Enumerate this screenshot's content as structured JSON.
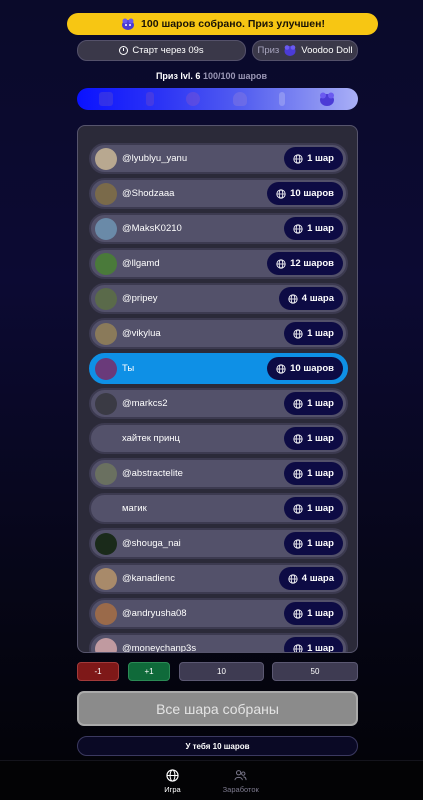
{
  "banner": {
    "text": "100 шаров собрано. Приз улучшен!",
    "icon": "prize-creature-icon"
  },
  "timer": {
    "text": "Старт через 09s",
    "icon": "clock-icon"
  },
  "prize": {
    "label": "Приз",
    "name": "Voodoo Doll",
    "icon": "voodoo-doll-icon"
  },
  "prize_level": {
    "label": "Приз lvl. 6",
    "progress": "100/100 шаров",
    "level": 6,
    "progress_value": 1.0
  },
  "levels": [
    "level-1-icon",
    "level-2-icon",
    "level-3-icon",
    "level-4-icon",
    "level-5-icon",
    "level-6-icon"
  ],
  "players": [
    {
      "name": "@lyublyu_yanu",
      "count": "1 шар",
      "avatar_color": "#b8a890"
    },
    {
      "name": "@Shodzaaa",
      "count": "10 шаров",
      "avatar_color": "#7a6a4a"
    },
    {
      "name": "@MaksK0210",
      "count": "1 шар",
      "avatar_color": "#6a8aa8"
    },
    {
      "name": "@llgamd",
      "count": "12 шаров",
      "avatar_color": "#4a7a3a"
    },
    {
      "name": "@pripey",
      "count": "4 шара",
      "avatar_color": "#5a6a4a"
    },
    {
      "name": "@vikylua",
      "count": "1 шар",
      "avatar_color": "#8a7a5a"
    },
    {
      "name": "Ты",
      "count": "10 шаров",
      "avatar_color": "#6a3a7a",
      "me": true
    },
    {
      "name": "@markcs2",
      "count": "1 шар",
      "avatar_color": "#3a3a44"
    },
    {
      "name": "хайтек принц",
      "count": "1 шар",
      "avatar_color": ""
    },
    {
      "name": "@abstractelite",
      "count": "1 шар",
      "avatar_color": "#6a7060"
    },
    {
      "name": "магик",
      "count": "1 шар",
      "avatar_color": ""
    },
    {
      "name": "@shouga_nai",
      "count": "1 шар",
      "avatar_color": "#1a2a1a"
    },
    {
      "name": "@kanadienc",
      "count": "4 шара",
      "avatar_color": "#a88a6a"
    },
    {
      "name": "@andryusha08",
      "count": "1 шар",
      "avatar_color": "#9a6a4a"
    },
    {
      "name": "@moneychanp3s",
      "count": "1 шар",
      "avatar_color": "#c09aa0"
    }
  ],
  "controls": {
    "minus": "-1",
    "plus": "+1",
    "ten": "10",
    "fifty": "50"
  },
  "collect_button": "Все шара собраны",
  "have_text": "У тебя 10 шаров",
  "nav": [
    {
      "label": "Игра",
      "icon": "globe-icon",
      "active": true
    },
    {
      "label": "Заработок",
      "icon": "users-icon",
      "active": false
    }
  ]
}
